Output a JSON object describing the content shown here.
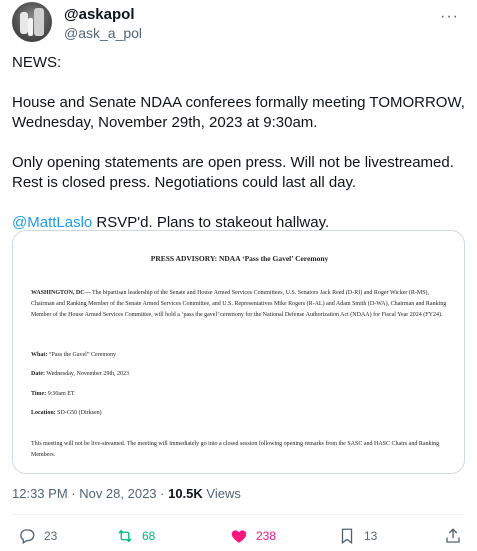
{
  "author": {
    "display_name": "@askapol",
    "handle": "@ask_a_pol",
    "more_icon": "more-horizontal-icon"
  },
  "tweet": {
    "paragraphs": [
      "NEWS:",
      "House and Senate NDAA conferees formally meeting TOMORROW, Wednesday, November 29th, 2023 at 9:30am.",
      "Only opening statements are open press. Will not be livestreamed. Rest is closed press. Negotiations could last all day."
    ],
    "mention": "@MattLaslo",
    "mention_rest": " RSVP'd. Plans to stakeout hallway."
  },
  "document": {
    "title": "PRESS ADVISORY: NDAA ‘Pass the Gavel’ Ceremony",
    "lead_label": "WASHINGTON, DC—",
    "lead_text": " The bipartisan leadership of the Senate and House Armed Services Committees, U.S. Senators Jack Reed (D-RI) and Roger Wicker (R-MS), Chairman and Ranking Member of the Senate Armed Services Committee, and U.S. Representatives Mike Rogers (R-AL) and Adam Smith (D-WA), Chairman and Ranking Member of the House Armed Services Committee, will hold a ‘pass the gavel’ ceremony for the National Defense Authorization Act (NDAA) for Fiscal Year 2024 (FY24).",
    "what_label": "What:",
    "what_value": " “Pass the Gavel” Ceremony",
    "date_label": "Date:",
    "date_value": " Wednesday, November 29th, 2023",
    "time_label": "Time:",
    "time_value": " 9:30am ET",
    "location_label": "Location:",
    "location_value": " SD-G50 (Dirksen)",
    "footer": "This meeting will not be live-streamed. The meeting will immediately go into a closed session following opening remarks from the SASC and HASC Chairs and Ranking Members."
  },
  "meta": {
    "timestamp": "12:33 PM · Nov 28, 2023 · ",
    "views_count": "10.5K",
    "views_label": " Views"
  },
  "actions": {
    "replies": "23",
    "reposts": "68",
    "likes": "238",
    "bookmarks": "13"
  },
  "colors": {
    "accent": "#1d9bf0",
    "repost": "#00ba7c",
    "like": "#f91880",
    "muted": "#536471"
  }
}
